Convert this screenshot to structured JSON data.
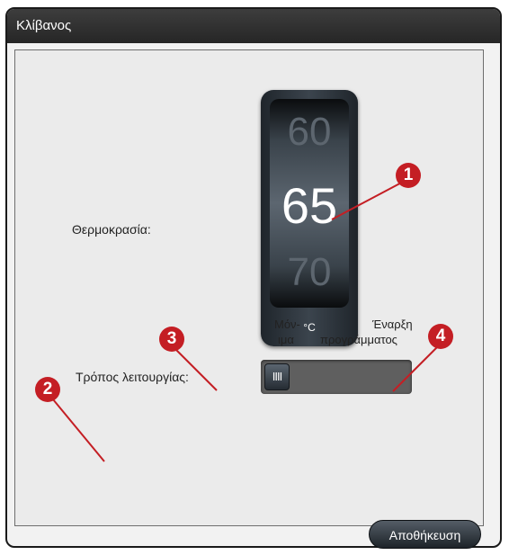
{
  "dialog": {
    "title": "Κλίβανος",
    "temperature_label": "Θερμοκρασία:",
    "temperature": {
      "prev": "60",
      "current": "65",
      "next": "70",
      "unit": "°C"
    },
    "mode_label": "Τρόπος λειτουργίας:",
    "mode_option_left_line1": "Μόν-",
    "mode_option_left_line2": "ιμα",
    "mode_option_right_line1": "Έναρξη",
    "mode_option_right_line2": "προγράμματος",
    "toggle_knob": "IIII",
    "save_label": "Αποθήκευση"
  },
  "callouts": [
    "1",
    "2",
    "3",
    "4"
  ],
  "colors": {
    "callout": "#c41e24",
    "titlebar": "#2e2e2e"
  }
}
